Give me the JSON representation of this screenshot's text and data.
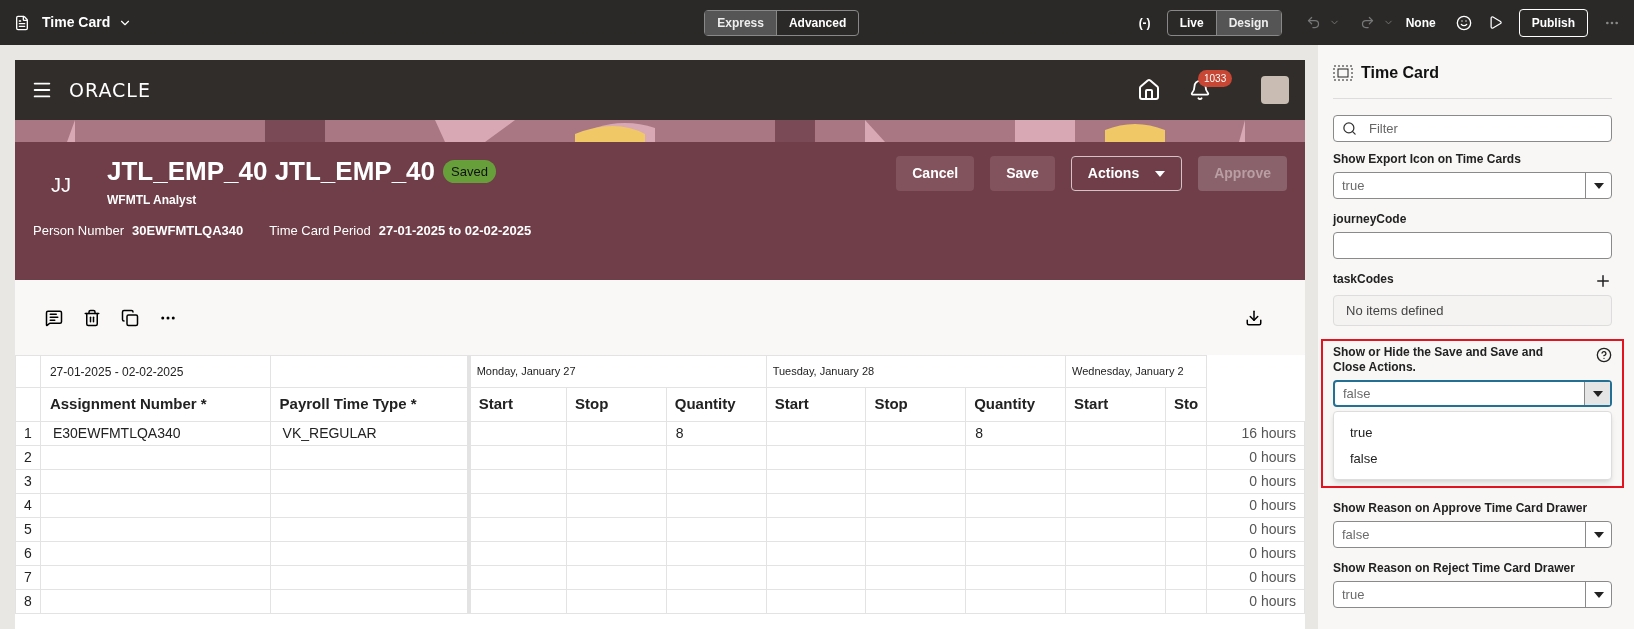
{
  "app_bar": {
    "title": "Time Card",
    "modes": [
      {
        "label": "Express",
        "selected": true
      },
      {
        "label": "Advanced",
        "selected": false
      }
    ],
    "views": [
      {
        "label": "Live",
        "selected": false
      },
      {
        "label": "Design",
        "selected": true
      }
    ],
    "variables_label": "(-)",
    "locale": "None",
    "publish": "Publish"
  },
  "page_header": {
    "brand": "ORACLE",
    "notification_count": "1033"
  },
  "employee": {
    "initials": "JJ",
    "name": "JTL_EMP_40 JTL_EMP_40",
    "status": "Saved",
    "role": "WFMTL Analyst",
    "fields": [
      {
        "label": "Person Number",
        "value": "30EWFMTLQA340"
      },
      {
        "label": "Time Card Period",
        "value": "27-01-2025 to 02-02-2025"
      }
    ]
  },
  "actions": [
    {
      "label": "Cancel",
      "kind": "solid",
      "disabled": false
    },
    {
      "label": "Save",
      "kind": "solid",
      "disabled": false
    },
    {
      "label": "Actions",
      "kind": "menu",
      "disabled": false
    },
    {
      "label": "Approve",
      "kind": "solid",
      "disabled": true
    }
  ],
  "table": {
    "period": "27-01-2025 - 02-02-2025",
    "fixed_columns": [
      "Assignment Number *",
      "Payroll Time Type *"
    ],
    "days": [
      {
        "date": "Monday, January 27",
        "columns": [
          "Start",
          "Stop",
          "Quantity"
        ]
      },
      {
        "date": "Tuesday, January 28",
        "columns": [
          "Start",
          "Stop",
          "Quantity"
        ]
      },
      {
        "date": "Wednesday, January 2",
        "columns": [
          "Start",
          "Sto"
        ]
      }
    ],
    "rows": [
      {
        "number": "1",
        "assignment_number": "E30EWFMTLQA340",
        "payroll_time_type": "VK_REGULAR",
        "day_quantities": [
          "8",
          "8"
        ],
        "total": "16 hours"
      },
      {
        "number": "2",
        "total": "0 hours"
      },
      {
        "number": "3",
        "total": "0 hours"
      },
      {
        "number": "4",
        "total": "0 hours"
      },
      {
        "number": "5",
        "total": "0 hours"
      },
      {
        "number": "6",
        "total": "0 hours"
      },
      {
        "number": "7",
        "total": "0 hours"
      },
      {
        "number": "8",
        "total": "0 hours"
      }
    ]
  },
  "properties_panel": {
    "title": "Time Card",
    "filter_placeholder": "Filter",
    "properties": [
      {
        "kind": "select",
        "label": "Show Export Icon on Time Cards",
        "value": "true",
        "expanded": false,
        "highlighted": false,
        "help": false
      },
      {
        "kind": "text",
        "label": "journeyCode",
        "highlighted": false,
        "help": false
      },
      {
        "kind": "list",
        "label": "taskCodes",
        "empty_text": "No items defined",
        "highlighted": false,
        "help": false
      },
      {
        "kind": "select",
        "label": "Show or Hide the Save and Save and Close Actions.",
        "value": "false",
        "expanded": true,
        "options": [
          "true",
          "false"
        ],
        "highlighted": true,
        "help": true
      },
      {
        "kind": "select",
        "label": "Show Reason on Approve Time Card Drawer",
        "value": "false",
        "expanded": false,
        "highlighted": false,
        "help": false
      },
      {
        "kind": "select",
        "label": "Show Reason on Reject Time Card Drawer",
        "value": "true",
        "expanded": false,
        "highlighted": false,
        "help": false
      }
    ]
  }
}
